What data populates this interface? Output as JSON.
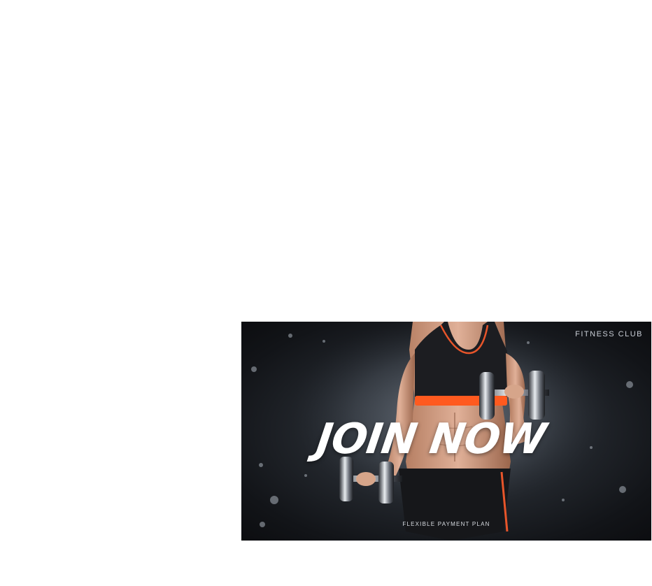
{
  "banner": {
    "brand": "FITNESS CLUB",
    "headline": "JOIN NOW",
    "tagline": "FLEXIBLE PAYMENT PLAN"
  },
  "colors": {
    "page_background": "#ffffff",
    "banner_dark": "#121418",
    "accent_orange": "#ff5a1f",
    "headline_text": "#ffffff"
  }
}
